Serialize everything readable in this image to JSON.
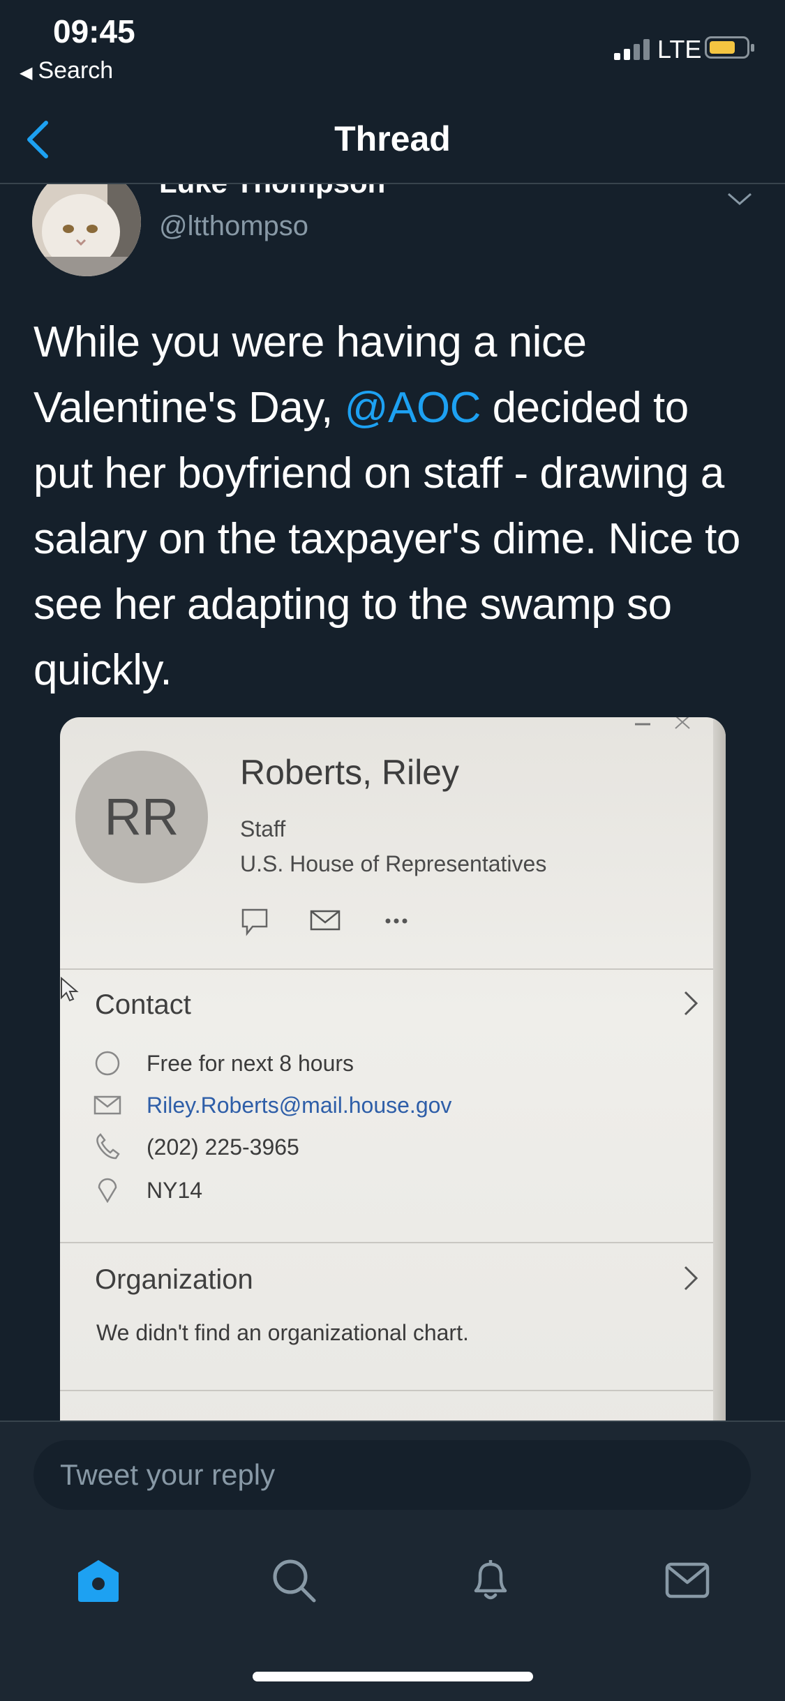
{
  "status_bar": {
    "time": "09:45",
    "back_app": "Search",
    "network": "LTE"
  },
  "nav": {
    "title": "Thread"
  },
  "tweet": {
    "author_name": "Luke Thompson",
    "author_handle": "@ltthompso",
    "text_before": "While you were having a nice Valentine's Day, ",
    "mention": "@AOC",
    "text_after": " decided to put her boyfriend on staff - drawing a salary on the taxpayer's dime. Nice to see her adapting to the swamp so quickly."
  },
  "photo_card": {
    "initials": "RR",
    "name": "Roberts, Riley",
    "role": "Staff",
    "organization": "U.S. House of Representatives",
    "contact_title": "Contact",
    "status": "Free for next 8 hours",
    "email": "Riley.Roberts@mail.house.gov",
    "phone": "(202) 225-3965",
    "location": "NY14",
    "org_title": "Organization",
    "org_note": "We didn't find an organizational chart."
  },
  "reply": {
    "placeholder": "Tweet your reply"
  },
  "tabs": [
    {
      "icon": "home-icon",
      "active": true
    },
    {
      "icon": "search-icon",
      "active": false
    },
    {
      "icon": "bell-icon",
      "active": false
    },
    {
      "icon": "mail-icon",
      "active": false
    }
  ],
  "colors": {
    "background": "#15202b",
    "accent": "#1da1f2",
    "muted": "#8899a6",
    "bar": "#1c2732"
  }
}
